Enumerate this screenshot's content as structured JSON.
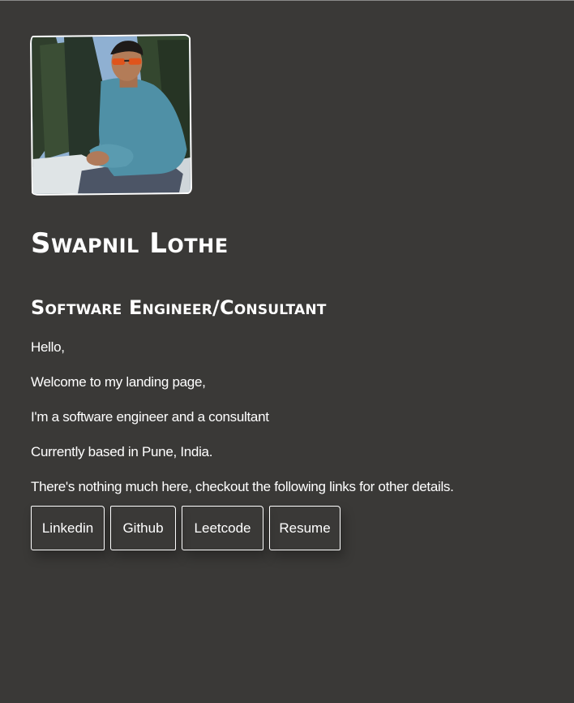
{
  "profile": {
    "name": "Swapnil Lothe",
    "role": "Software Engineer/Consultant",
    "avatar_alt": "profile photo"
  },
  "intro": [
    "Hello,",
    "Welcome to my landing page,",
    "I'm a software engineer and a consultant",
    "Currently based in Pune, India.",
    "There's nothing much here, checkout the following links for other details."
  ],
  "links": [
    {
      "label": "Linkedin"
    },
    {
      "label": "Github"
    },
    {
      "label": "Leetcode"
    },
    {
      "label": "Resume"
    }
  ],
  "colors": {
    "background": "#3a3937",
    "text": "#ffffff",
    "border": "#ffffff"
  }
}
